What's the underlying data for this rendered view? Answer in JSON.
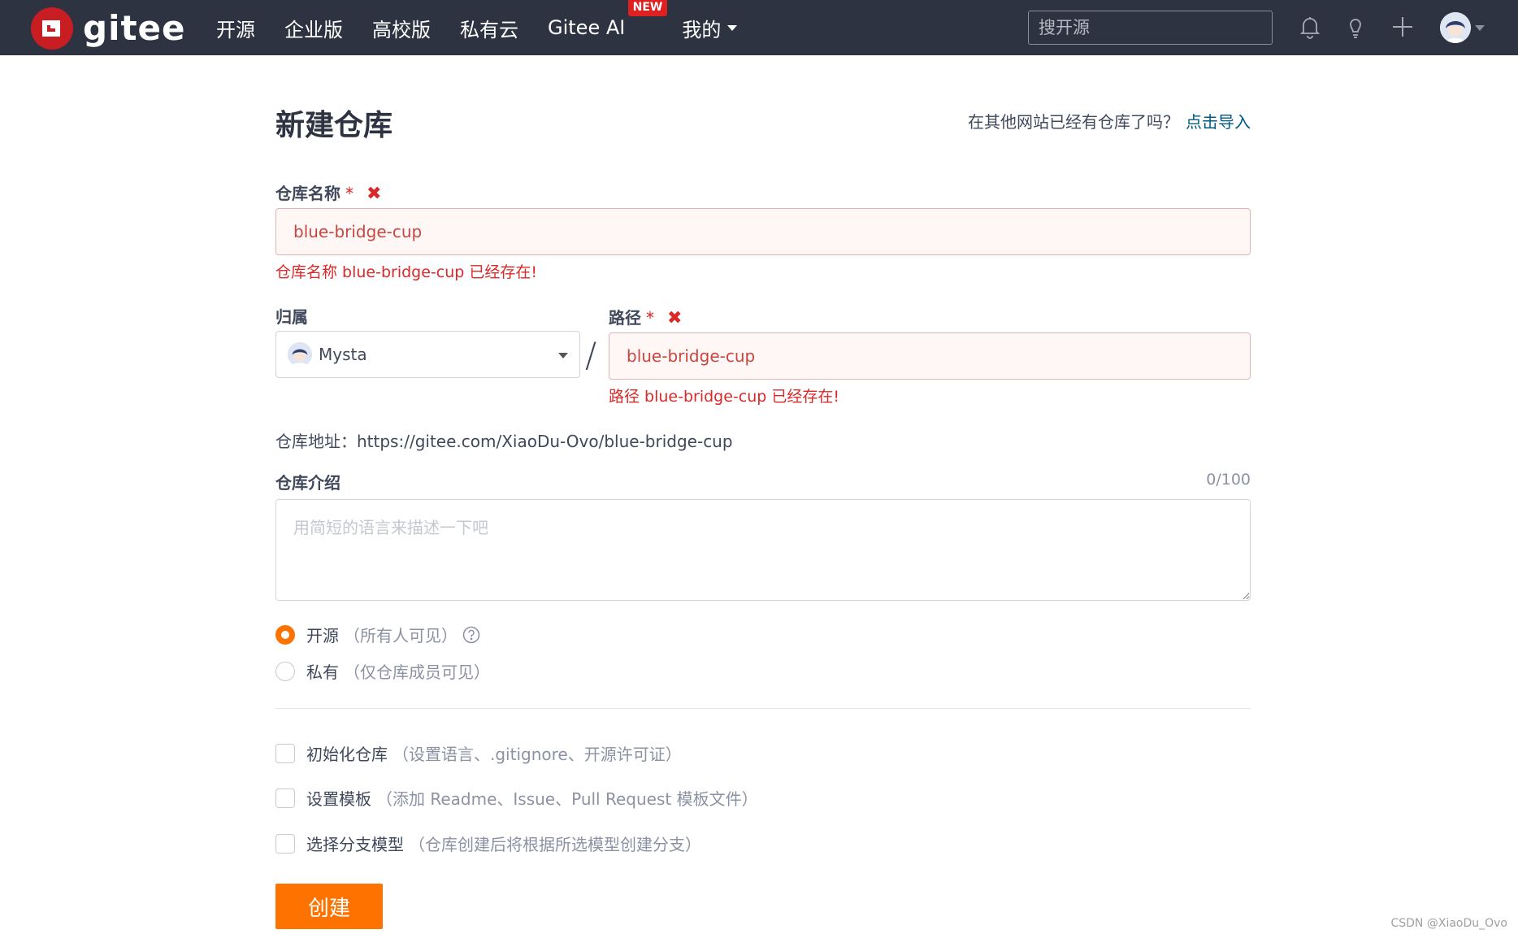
{
  "nav": {
    "logo_text": "gitee",
    "items": [
      "开源",
      "企业版",
      "高校版",
      "私有云",
      "Gitee AI"
    ],
    "new_badge": "NEW",
    "mine": "我的",
    "search_placeholder": "搜开源",
    "icons": [
      "bell-icon",
      "lightbulb-icon",
      "plus-icon",
      "avatar"
    ]
  },
  "header": {
    "title": "新建仓库",
    "import_question": "在其他网站已经有仓库了吗？",
    "import_link": "点击导入"
  },
  "form": {
    "repo_name": {
      "label": "仓库名称",
      "required": "*",
      "error_icon": "✖",
      "value": "blue-bridge-cup",
      "error": "仓库名称 blue-bridge-cup 已经存在!"
    },
    "owner": {
      "label": "归属",
      "value": "Mysta"
    },
    "separator": "/",
    "path": {
      "label": "路径",
      "required": "*",
      "error_icon": "✖",
      "value": "blue-bridge-cup",
      "error": "路径 blue-bridge-cup 已经存在!"
    },
    "repo_url": "仓库地址：https://gitee.com/XiaoDu-Ovo/blue-bridge-cup",
    "description": {
      "label": "仓库介绍",
      "counter": "0/100",
      "placeholder": "用简短的语言来描述一下吧"
    },
    "visibility": [
      {
        "label": "开源",
        "sub": "（所有人可见）",
        "checked": true
      },
      {
        "label": "私有",
        "sub": "（仅仓库成员可见）",
        "checked": false
      }
    ],
    "options": [
      {
        "label": "初始化仓库",
        "sub": "（设置语言、.gitignore、开源许可证）",
        "checked": false
      },
      {
        "label": "设置模板",
        "sub": "（添加 Readme、Issue、Pull Request 模板文件）",
        "checked": false
      },
      {
        "label": "选择分支模型",
        "sub": "（仓库创建后将根据所选模型创建分支）",
        "checked": false
      }
    ],
    "submit": "创建"
  },
  "watermark": "CSDN @XiaoDu_Ovo",
  "colors": {
    "nav_bg": "#2e3342",
    "brand_red": "#c71d23",
    "accent_orange": "#fe7300",
    "error_red": "#db2828",
    "link_blue": "#005980"
  }
}
